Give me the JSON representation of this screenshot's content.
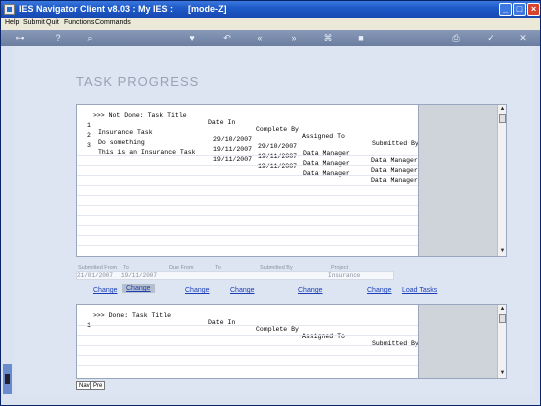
{
  "window": {
    "title": "IES Navigator Client v8.03 : My IES :      [mode-Z]"
  },
  "menu": [
    "Help",
    "Submit",
    "Quit",
    "Functions",
    "Commands"
  ],
  "toolbar_icons": [
    "key-icon",
    "help-icon",
    "search-icon",
    "heart-icon",
    "back-icon",
    "rewind-icon",
    "forward-icon",
    "bookmark-icon",
    "stop-icon",
    "print-icon",
    "check-icon",
    "close-icon"
  ],
  "page_title": "TASK PROGRESS",
  "grid_top": {
    "header": ">>> Not Done: Task Title",
    "columns": [
      "Date In",
      "Complete By",
      "Assigned To",
      "Submitted By"
    ],
    "rows": [
      {
        "num": "1",
        "title": "Insurance Task",
        "date_in": "29/10/2007",
        "complete_by": "29/10/2007",
        "assigned_to": "Data Manager",
        "submitted_by": "Data Manager"
      },
      {
        "num": "2",
        "title": "Do something",
        "date_in": "19/11/2007",
        "complete_by": "19/11/2007",
        "assigned_to": "Data Manager",
        "submitted_by": "Data Manager"
      },
      {
        "num": "3",
        "title": "This is an Insurance Task",
        "date_in": "19/11/2007",
        "complete_by": "19/11/2007",
        "assigned_to": "Data Manager",
        "submitted_by": "Data Manager"
      }
    ]
  },
  "filters": {
    "labels": [
      "Submitted From",
      "To",
      "Due From",
      "To",
      "Submitted By",
      "Project"
    ],
    "submitted_from": "21/01/2007",
    "to": "19/11/2007",
    "project": "Insurance"
  },
  "actions": [
    "Change",
    "Change",
    "Change",
    "Change",
    "Change",
    "Change",
    "Load Tasks"
  ],
  "grid_bottom": {
    "header": ">>> Done: Task Title",
    "columns": [
      "Date In",
      "Complete By",
      "Assigned To",
      "Submitted By"
    ],
    "rows": [
      {
        "num": "1"
      }
    ]
  },
  "tabs": [
    "Nav",
    "Pre"
  ]
}
